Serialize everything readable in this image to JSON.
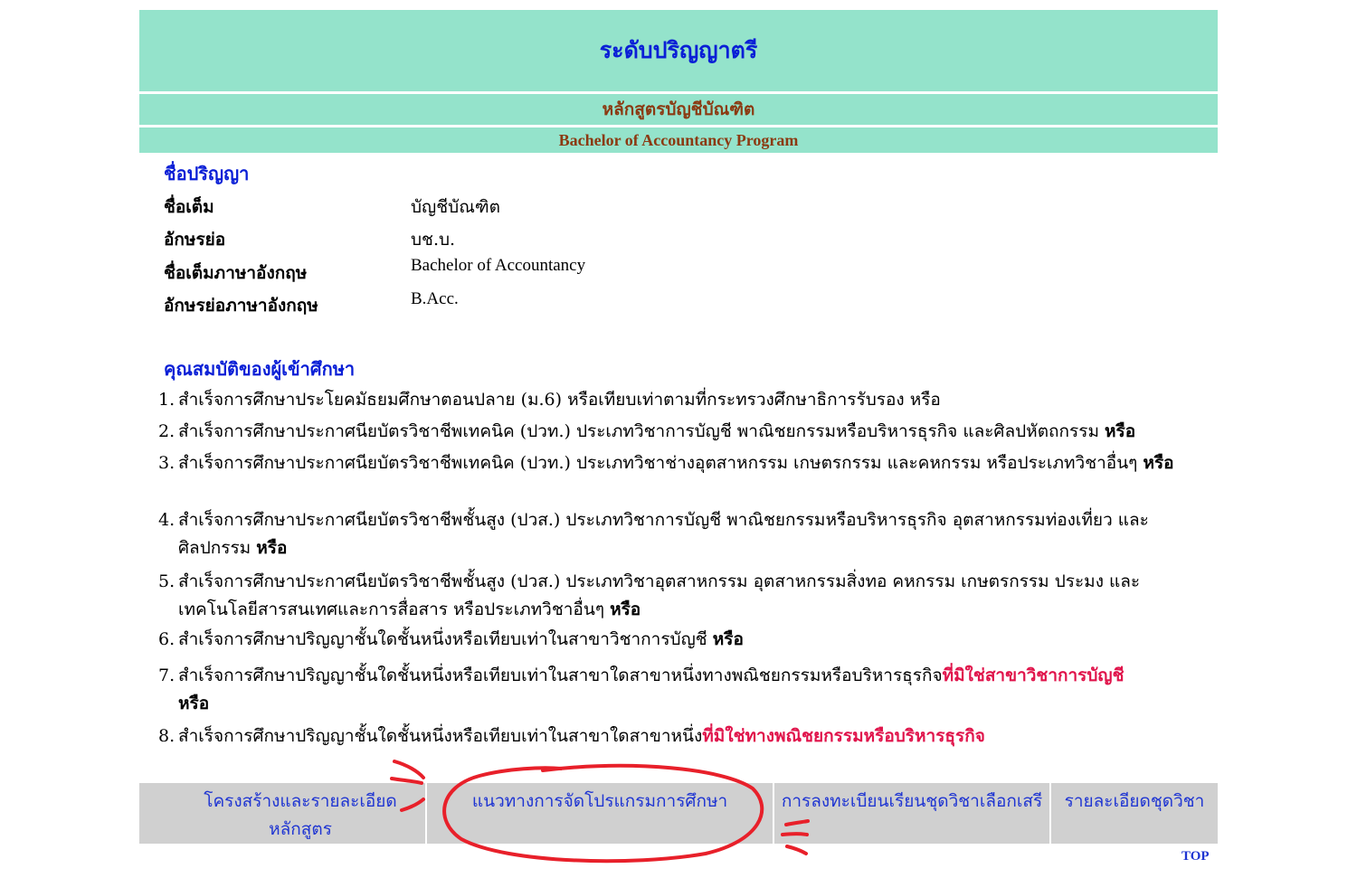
{
  "header": {
    "title": "ระดับปริญญาตรี",
    "program_th": "หลักสูตรบัญชีบัณฑิต",
    "program_en": "Bachelor of Accountancy Program"
  },
  "degree": {
    "heading": "ชื่อปริญญา",
    "rows": [
      {
        "label": "ชื่อเต็ม",
        "value": "บัญชีบัณฑิต"
      },
      {
        "label": "อักษรย่อ",
        "value": "บช.บ."
      },
      {
        "label": "ชื่อเต็มภาษาอังกฤษ",
        "value": "Bachelor of Accountancy"
      },
      {
        "label": "อักษรย่อภาษาอังกฤษ",
        "value": "B.Acc."
      }
    ]
  },
  "qualifications": {
    "heading": "คุณสมบัติของผู้เข้าศึกษา",
    "items": [
      {
        "num": "1.",
        "text": "สำเร็จการศึกษาประโยคมัธยมศึกษาตอนปลาย (ม.6) หรือเทียบเท่าตามที่กระทรวงศึกษาธิการรับรอง หรือ",
        "bold": "",
        "red": ""
      },
      {
        "num": "2.",
        "text": "สำเร็จการศึกษาประกาศนียบัตรวิชาชีพเทคนิค (ปวท.) ประเภทวิชาการบัญชี พาณิชยกรรมหรือบริหารธุรกิจ และศิลปหัตถกรรม ",
        "bold": "หรือ",
        "red": ""
      },
      {
        "num": "3.",
        "text": "สำเร็จการศึกษาประกาศนียบัตรวิชาชีพเทคนิค (ปวท.) ประเภทวิชาช่างอุตสาหกรรม เกษตรกรรม และคหกรรม หรือประเภทวิชาอื่นๆ ",
        "bold": "หรือ",
        "red": ""
      },
      {
        "num": "4.",
        "text": "สำเร็จการศึกษาประกาศนียบัตรวิชาชีพชั้นสูง (ปวส.) ประเภทวิชาการบัญชี พาณิชยกรรมหรือบริหารธุรกิจ อุตสาหกรรมท่องเที่ยว และศิลปกรรม ",
        "bold": "หรือ",
        "red": ""
      },
      {
        "num": "5.",
        "text": "สำเร็จการศึกษาประกาศนียบัตรวิชาชีพชั้นสูง (ปวส.) ประเภทวิชาอุตสาหกรรม อุตสาหกรรมสิ่งทอ คหกรรม เกษตรกรรม ประมง และเทคโนโลยีสารสนเทศและการสื่อสาร หรือประเภทวิชาอื่นๆ ",
        "bold": "หรือ",
        "red": ""
      },
      {
        "num": "6.",
        "text": "สำเร็จการศึกษาปริญญาชั้นใดชั้นหนึ่งหรือเทียบเท่าในสาขาวิชาการบัญชี ",
        "bold": "หรือ",
        "red": ""
      },
      {
        "num": "7.",
        "text": "สำเร็จการศึกษาปริญญาชั้นใดชั้นหนึ่งหรือเทียบเท่าในสาขาใดสาขาหนึ่งทางพณิชยกรรมหรือบริหารธุรกิจ",
        "red": "ที่มิใช่สาขาวิชาการบัญชี",
        "bold": "หรือ"
      },
      {
        "num": "8.",
        "text": "สำเร็จการศึกษาปริญญาชั้นใดชั้นหนึ่งหรือเทียบเท่าในสาขาใดสาขาหนึ่ง",
        "red": "ที่มิใช่ทางพณิชยกรรมหรือบริหารธุรกิจ",
        "bold": ""
      }
    ]
  },
  "nav": {
    "items": [
      "โครงสร้างและรายละเอียดหลักสูตร",
      "แนวทางการจัดโปรแกรมการศึกษา",
      "การลงทะเบียนเรียนชุดวิชาเลือกเสรี",
      "รายละเอียดชุดวิชา"
    ],
    "top_label": "TOP"
  },
  "colors": {
    "header_bg": "#94e3cb",
    "title_blue": "#0a1fd6",
    "program_brown": "#8b3a12",
    "highlight_red": "#e0144b",
    "nav_bg": "#d0d0d0",
    "annotation_red": "#e8202a"
  }
}
